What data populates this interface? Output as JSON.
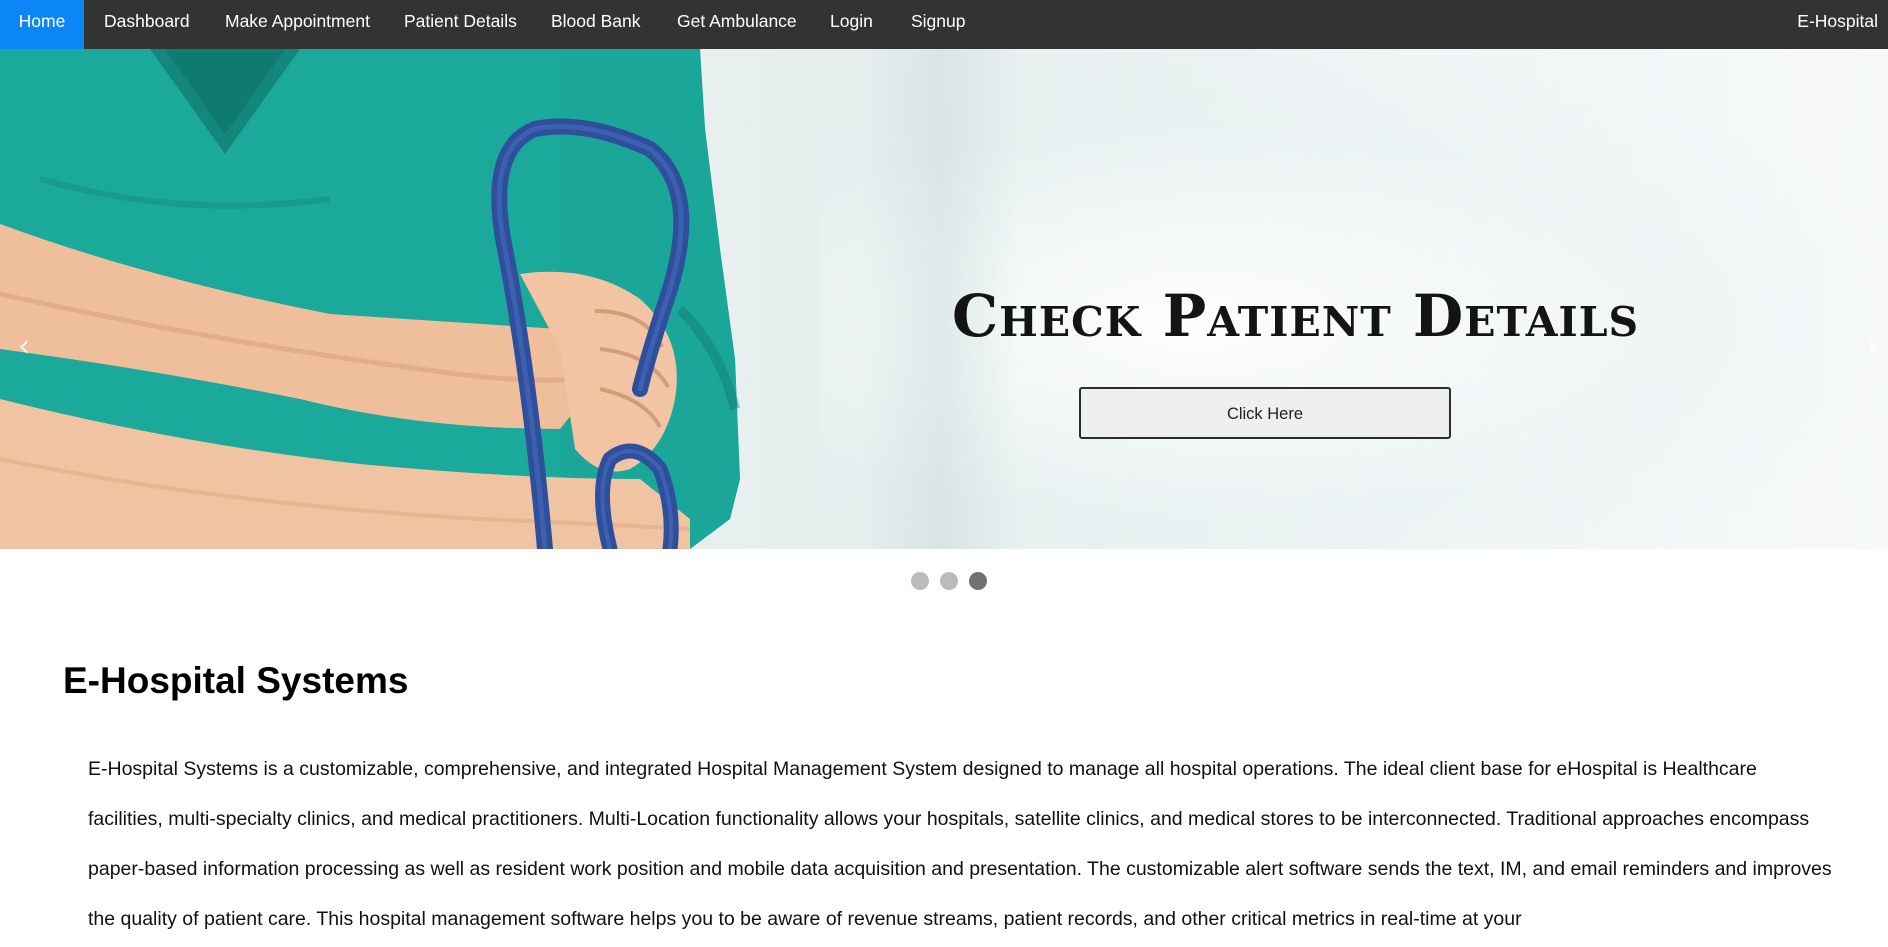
{
  "nav": {
    "items": [
      {
        "label": "Home",
        "active": true
      },
      {
        "label": "Dashboard"
      },
      {
        "label": "Make Appointment"
      },
      {
        "label": "Patient Details"
      },
      {
        "label": "Blood Bank"
      },
      {
        "label": "Get Ambulance"
      },
      {
        "label": "Login"
      },
      {
        "label": "Signup"
      }
    ],
    "brand": "E-Hospital"
  },
  "hero": {
    "title": "Check Patient Details",
    "button_label": "Click Here",
    "prev_arrow": "‹",
    "next_arrow": "›",
    "slide_count": 3,
    "active_slide": 3
  },
  "section": {
    "title": "E-Hospital Systems",
    "body": "E-Hospital Systems is a customizable, comprehensive, and integrated Hospital Management System designed to manage all hospital operations. The ideal client base for eHospital is Healthcare facilities, multi-specialty clinics, and medical practitioners. Multi-Location functionality allows your hospitals, satellite clinics, and medical stores to be interconnected. Traditional approaches encompass paper-based information processing as well as resident work position and mobile data acquisition and presentation. The customizable alert software sends the text, IM, and email reminders and improves the quality of patient care. This hospital management software helps you to be aware of revenue streams, patient records, and other critical metrics in real-time at your"
  },
  "colors": {
    "nav_bg": "#333333",
    "nav_active": "#0c86f6",
    "scrubs": "#1aa99a",
    "stethoscope": "#2e4f9c",
    "dot_inactive": "#bbbbbb",
    "dot_active": "#717171"
  }
}
